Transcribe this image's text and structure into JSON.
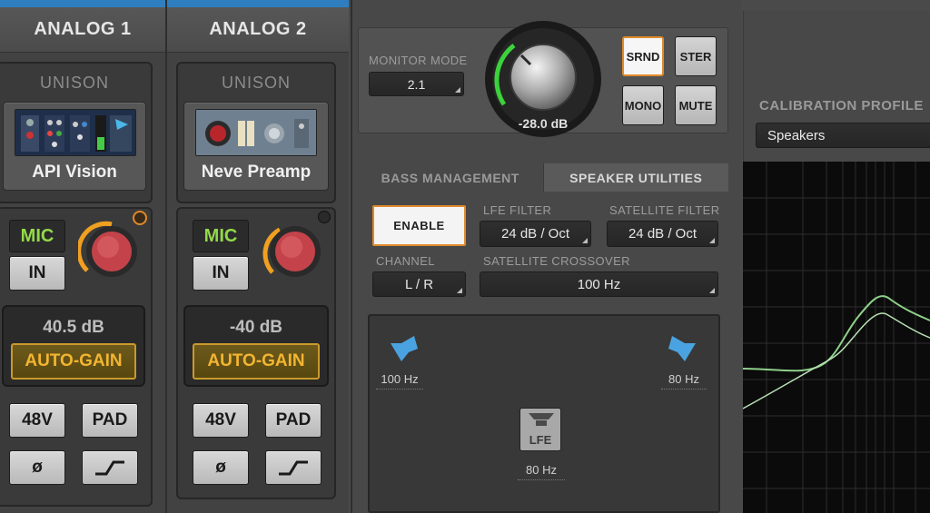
{
  "channels": [
    {
      "header": "ANALOG 1",
      "unison_label": "UNISON",
      "plugin_name": "API Vision",
      "mic_label": "MIC",
      "in_label": "IN",
      "gain_value": "40.5 dB",
      "autogain_label": "AUTO-GAIN",
      "btn_48v": "48V",
      "btn_pad": "PAD",
      "btn_phase": "ø",
      "led_color": "#e08a2a"
    },
    {
      "header": "ANALOG 2",
      "unison_label": "UNISON",
      "plugin_name": "Neve Preamp",
      "mic_label": "MIC",
      "in_label": "IN",
      "gain_value": "-40 dB",
      "autogain_label": "AUTO-GAIN",
      "btn_48v": "48V",
      "btn_pad": "PAD",
      "btn_phase": "ø",
      "led_color": "#2a2a2a"
    }
  ],
  "monitor": {
    "mode_label": "MONITOR MODE",
    "mode_value": "2.1",
    "level_value": "-28.0 dB",
    "buttons": {
      "srnd": "SRND",
      "ster": "STER",
      "mono": "MONO",
      "mute": "MUTE"
    }
  },
  "tabs": {
    "bass_management": "BASS MANAGEMENT",
    "speaker_utilities": "SPEAKER UTILITIES"
  },
  "bass": {
    "enable_label": "ENABLE",
    "lfe_filter_label": "LFE FILTER",
    "lfe_filter_value": "24 dB / Oct",
    "satellite_filter_label": "SATELLITE FILTER",
    "satellite_filter_value": "24 dB / Oct",
    "channel_label": "CHANNEL",
    "channel_value": "L / R",
    "crossover_label": "SATELLITE CROSSOVER",
    "crossover_value": "100 Hz"
  },
  "speakers": {
    "left_freq": "100 Hz",
    "right_freq": "80 Hz",
    "lfe_label": "LFE",
    "lfe_freq": "80 Hz"
  },
  "calibration": {
    "label": "CALIBRATION PROFILE",
    "profile_value": "Speakers"
  },
  "colors": {
    "accent_orange": "#e08a2a",
    "mic_green": "#93d94a",
    "autogain_gold": "#f2b531",
    "speaker_blue": "#4aa3e0",
    "meter_green": "#3cd23c",
    "header_blue": "#2f7fc0"
  }
}
